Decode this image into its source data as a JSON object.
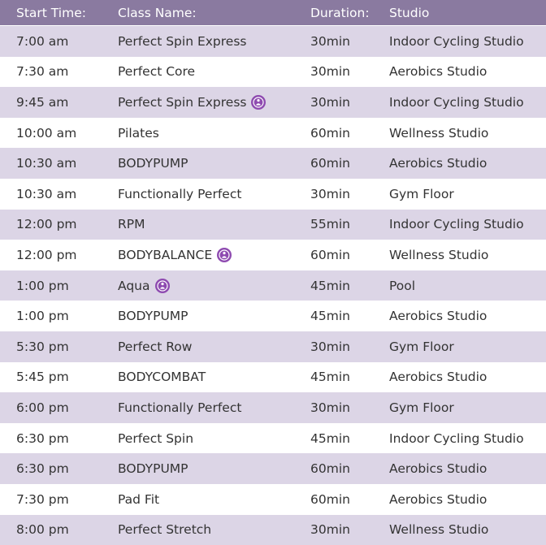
{
  "header": {
    "start_time": "Start Time:",
    "class_name": "Class Name:",
    "duration": "Duration:",
    "studio": "Studio"
  },
  "colors": {
    "header_bg": "#8a7aa0",
    "shaded_row": "#dcd5e6",
    "badge": "#8e4ab0"
  },
  "badge_icon": "members-only-icon",
  "rows": [
    {
      "time": "7:00 am",
      "name": "Perfect Spin Express",
      "duration": "30min",
      "studio": "Indoor Cycling Studio",
      "badge": false
    },
    {
      "time": "7:30 am",
      "name": "Perfect Core",
      "duration": "30min",
      "studio": "Aerobics Studio",
      "badge": false
    },
    {
      "time": "9:45 am",
      "name": "Perfect Spin Express",
      "duration": "30min",
      "studio": "Indoor Cycling Studio",
      "badge": true
    },
    {
      "time": "10:00 am",
      "name": "Pilates",
      "duration": "60min",
      "studio": "Wellness Studio",
      "badge": false
    },
    {
      "time": "10:30 am",
      "name": "BODYPUMP",
      "duration": "60min",
      "studio": "Aerobics Studio",
      "badge": false
    },
    {
      "time": "10:30 am",
      "name": "Functionally Perfect",
      "duration": "30min",
      "studio": "Gym Floor",
      "badge": false
    },
    {
      "time": "12:00 pm",
      "name": "RPM",
      "duration": "55min",
      "studio": "Indoor Cycling Studio",
      "badge": false
    },
    {
      "time": "12:00 pm",
      "name": "BODYBALANCE",
      "duration": "60min",
      "studio": "Wellness Studio",
      "badge": true
    },
    {
      "time": "1:00 pm",
      "name": "Aqua",
      "duration": "45min",
      "studio": "Pool",
      "badge": true
    },
    {
      "time": "1:00 pm",
      "name": "BODYPUMP",
      "duration": "45min",
      "studio": "Aerobics Studio",
      "badge": false
    },
    {
      "time": "5:30 pm",
      "name": "Perfect Row",
      "duration": "30min",
      "studio": "Gym Floor",
      "badge": false
    },
    {
      "time": "5:45 pm",
      "name": "BODYCOMBAT",
      "duration": "45min",
      "studio": "Aerobics Studio",
      "badge": false
    },
    {
      "time": "6:00 pm",
      "name": "Functionally Perfect",
      "duration": "30min",
      "studio": "Gym Floor",
      "badge": false
    },
    {
      "time": "6:30 pm",
      "name": "Perfect Spin",
      "duration": "45min",
      "studio": "Indoor Cycling Studio",
      "badge": false
    },
    {
      "time": "6:30 pm",
      "name": "BODYPUMP",
      "duration": "60min",
      "studio": "Aerobics Studio",
      "badge": false
    },
    {
      "time": "7:30 pm",
      "name": "Pad Fit",
      "duration": "60min",
      "studio": "Aerobics Studio",
      "badge": false
    },
    {
      "time": "8:00 pm",
      "name": "Perfect Stretch",
      "duration": "30min",
      "studio": "Wellness Studio",
      "badge": false
    }
  ]
}
